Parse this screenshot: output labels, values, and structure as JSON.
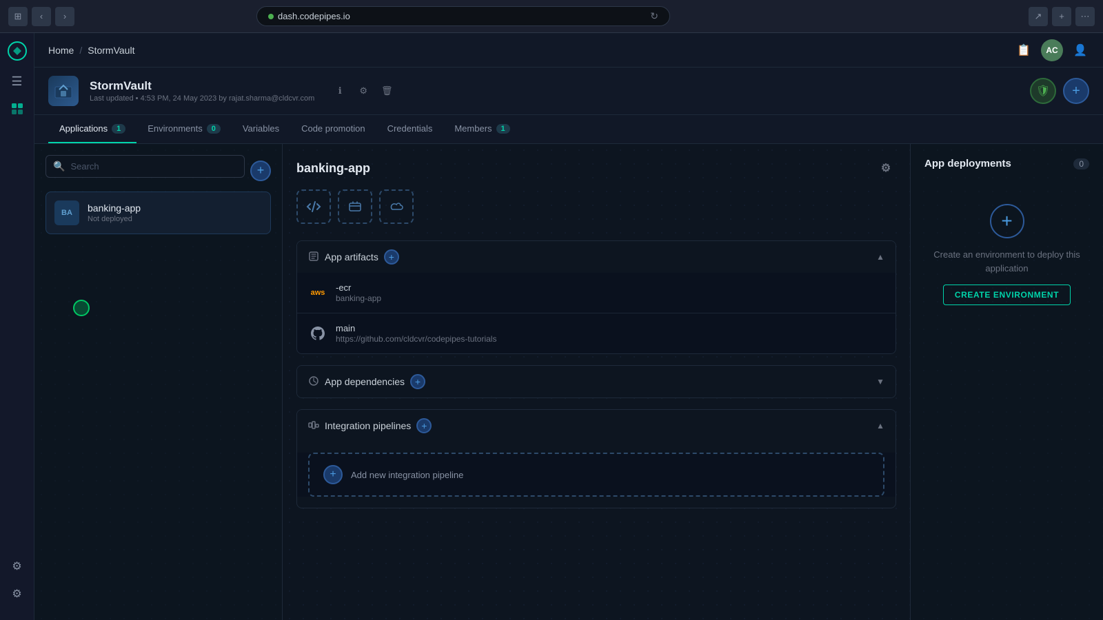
{
  "browser": {
    "url": "dash.codepipes.io",
    "back_btn": "‹",
    "forward_btn": "›"
  },
  "topnav": {
    "breadcrumb_home": "Home",
    "breadcrumb_sep": "/",
    "breadcrumb_current": "StormVault",
    "avatar_initials": "AC"
  },
  "project": {
    "name": "StormVault",
    "meta": "Last updated • 4:53 PM, 24 May 2023 by rajat.sharma@cldcvr.com"
  },
  "tabs": [
    {
      "id": "applications",
      "label": "Applications",
      "badge": "1",
      "active": true
    },
    {
      "id": "environments",
      "label": "Environments",
      "badge": "0",
      "active": false
    },
    {
      "id": "variables",
      "label": "Variables",
      "badge": null,
      "active": false
    },
    {
      "id": "code_promotion",
      "label": "Code promotion",
      "badge": null,
      "active": false
    },
    {
      "id": "credentials",
      "label": "Credentials",
      "badge": null,
      "active": false
    },
    {
      "id": "members",
      "label": "Members",
      "badge": "1",
      "active": false
    }
  ],
  "search": {
    "placeholder": "Search"
  },
  "app_list": [
    {
      "initials": "BA",
      "name": "banking-app",
      "status": "Not deployed"
    }
  ],
  "main_app": {
    "title": "banking-app"
  },
  "sections": {
    "artifacts": {
      "title": "App artifacts",
      "items": [
        {
          "type": "aws",
          "name": "-ecr",
          "sub": "banking-app"
        },
        {
          "type": "github",
          "name": "main",
          "sub": "https://github.com/cldcvr/codepipes-tutorials"
        }
      ]
    },
    "dependencies": {
      "title": "App dependencies"
    },
    "pipelines": {
      "title": "Integration pipelines",
      "add_label": "Add new integration pipeline"
    }
  },
  "deployments": {
    "title": "App deployments",
    "count": "0",
    "empty_message": "Create an environment to deploy this application",
    "create_btn": "CREATE ENVIRONMENT"
  }
}
